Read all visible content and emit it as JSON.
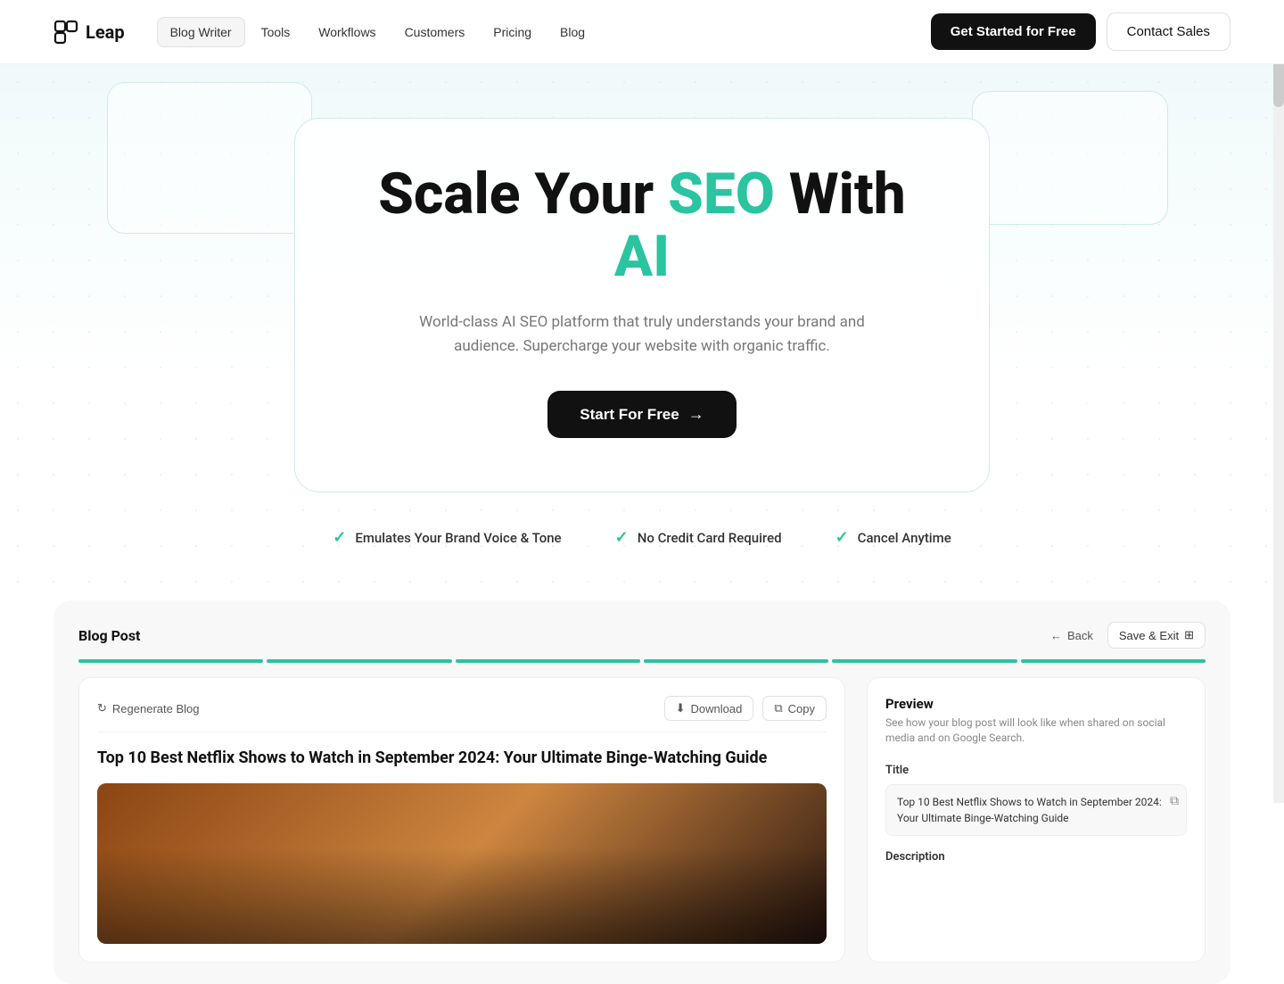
{
  "brand": {
    "name": "Leap",
    "logo_icon": "◱"
  },
  "navbar": {
    "links": [
      {
        "label": "Blog Writer",
        "active": true
      },
      {
        "label": "Tools",
        "active": false
      },
      {
        "label": "Workflows",
        "active": false
      },
      {
        "label": "Customers",
        "active": false
      },
      {
        "label": "Pricing",
        "active": false
      },
      {
        "label": "Blog",
        "active": false
      }
    ],
    "cta_primary": "Get Started for Free",
    "cta_secondary": "Contact Sales"
  },
  "hero": {
    "title_part1": "Scale Your ",
    "title_highlight1": "SEO",
    "title_part2": " With ",
    "title_highlight2": "AI",
    "subtitle": "World-class AI SEO platform that truly understands your brand and audience. Supercharge your website with organic traffic.",
    "cta_label": "Start For Free",
    "cta_arrow": "→"
  },
  "features": [
    {
      "label": "Emulates Your Brand Voice & Tone"
    },
    {
      "label": "No Credit Card Required"
    },
    {
      "label": "Cancel Anytime"
    }
  ],
  "blog_section": {
    "title": "Blog Post",
    "back_label": "Back",
    "save_exit_label": "Save & Exit",
    "progress_segments": 6,
    "editor": {
      "regenerate_label": "Regenerate Blog",
      "download_label": "Download",
      "copy_label": "Copy",
      "post_title": "Top 10 Best Netflix Shows to Watch in September 2024: Your Ultimate Binge-Watching Guide"
    },
    "preview": {
      "title": "Preview",
      "subtitle": "See how your blog post will look like when shared on social media and on Google Search.",
      "title_label": "Title",
      "title_value": "Top 10 Best Netflix Shows to Watch in September 2024: Your Ultimate Binge-Watching Guide",
      "description_label": "Description"
    }
  },
  "colors": {
    "teal": "#2ac4a0",
    "dark": "#111111",
    "muted": "#777777"
  }
}
